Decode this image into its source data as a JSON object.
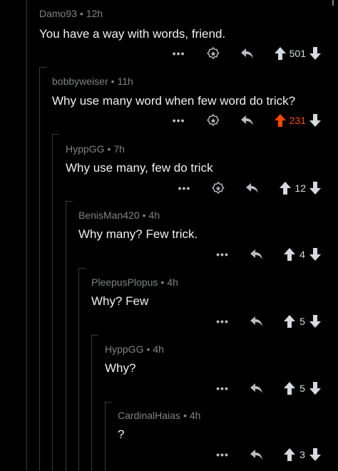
{
  "comments": [
    {
      "author": "Damo93",
      "time": "12h",
      "text": "You have a way with words, friend.",
      "more": "•••",
      "score": "501",
      "upvoted": false,
      "award": true
    },
    {
      "author": "bobbyweiser",
      "time": "11h",
      "text": "Why use many word when few word do trick?",
      "more": "•••",
      "score": "231",
      "upvoted": true,
      "award": true
    },
    {
      "author": "HyppGG",
      "time": "7h",
      "text": "Why use many, few do trick",
      "more": "•••",
      "score": "12",
      "upvoted": false,
      "award": true
    },
    {
      "author": "BenisMan420",
      "time": "4h",
      "text": "Why many? Few trick.",
      "more": "•••",
      "score": "4",
      "upvoted": false,
      "award": false
    },
    {
      "author": "PleepusPlopus",
      "time": "4h",
      "text": "Why? Few",
      "more": "•••",
      "score": "5",
      "upvoted": false,
      "award": false
    },
    {
      "author": "HyppGG",
      "time": "4h",
      "text": "Why?",
      "more": "•••",
      "score": "5",
      "upvoted": false,
      "award": false
    },
    {
      "author": "CardinalHaias",
      "time": "4h",
      "text": "?",
      "more": "•••",
      "score": "3",
      "upvoted": false,
      "award": false
    }
  ],
  "separator": "•",
  "colors": {
    "background": "#000000",
    "upvoted": "#ff4500",
    "meta": "#818384",
    "text": "#f0f0f0"
  },
  "icons": [
    "more-icon",
    "award-icon",
    "reply-arrow-icon",
    "upvote-arrow-icon",
    "downvote-arrow-icon"
  ]
}
